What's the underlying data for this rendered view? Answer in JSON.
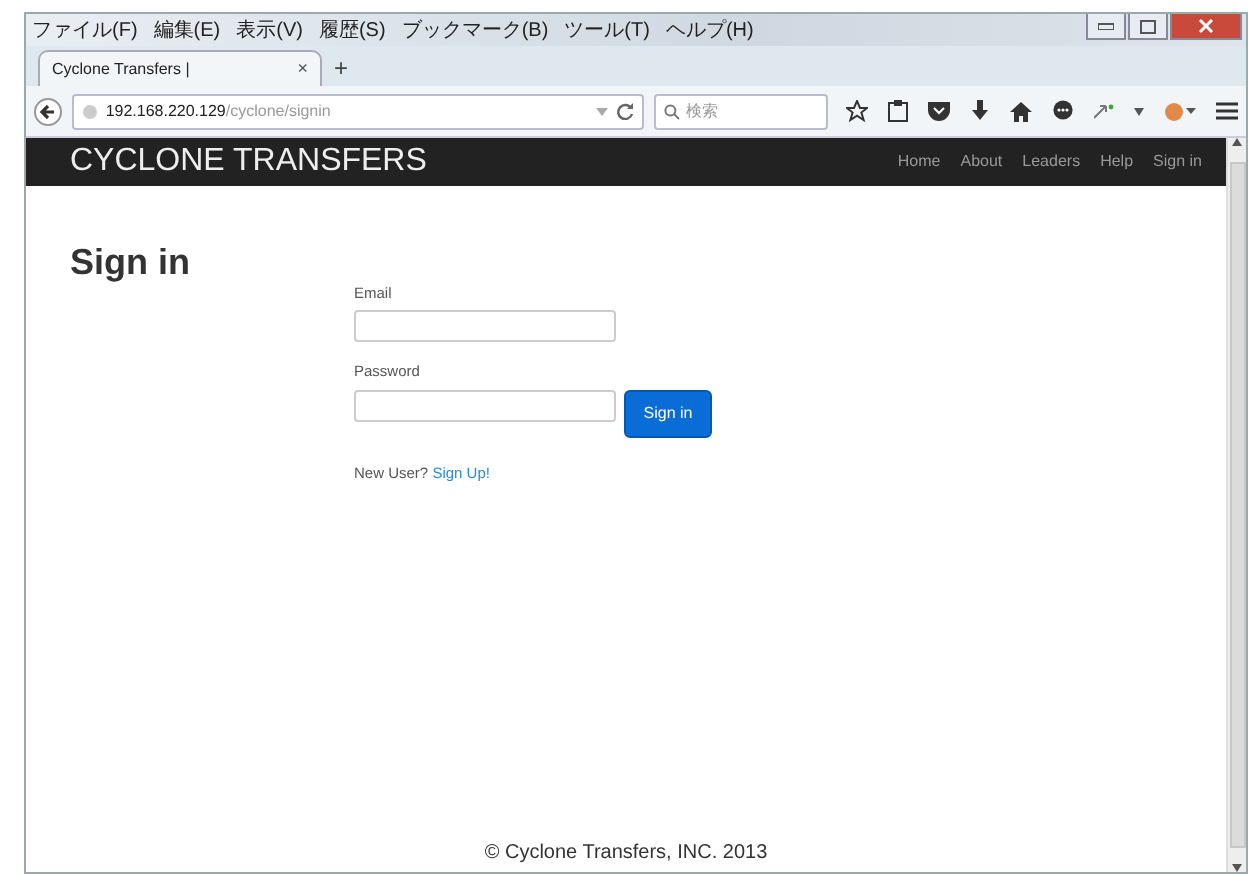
{
  "menu": [
    "ファイル(F)",
    "編集(E)",
    "表示(V)",
    "履歴(S)",
    "ブックマーク(B)",
    "ツール(T)",
    "ヘルプ(H)"
  ],
  "tab": {
    "title": "Cyclone Transfers |",
    "close": "×",
    "new_tab": "+"
  },
  "address": {
    "host": "192.168.220.129",
    "path": "/cyclone/signin"
  },
  "search": {
    "placeholder": "検索"
  },
  "navbar": {
    "brand": "CYCLONE TRANSFERS",
    "links": [
      "Home",
      "About",
      "Leaders",
      "Help",
      "Sign in"
    ]
  },
  "heading": "Sign in",
  "form": {
    "fields": [
      {
        "label": "Email"
      },
      {
        "label": "Password"
      }
    ],
    "submit": "Sign in",
    "new_user": "New User?",
    "signup_link": "Sign Up!"
  },
  "footer": "© Cyclone Transfers, INC. 2013"
}
